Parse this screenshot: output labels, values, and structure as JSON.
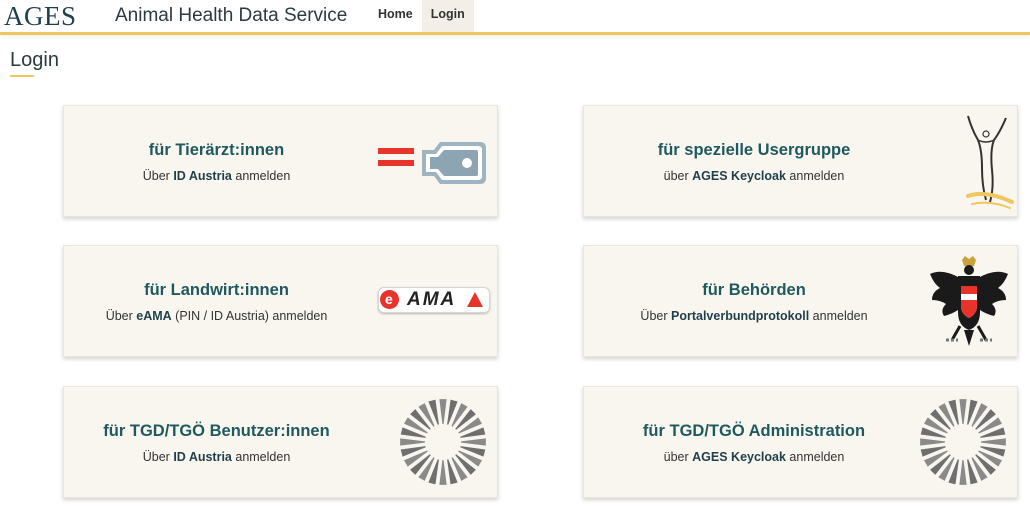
{
  "header": {
    "logo_text": "AGES",
    "app_title": "Animal Health Data Service",
    "nav": [
      {
        "label": "Home"
      },
      {
        "label": "Login"
      }
    ]
  },
  "page": {
    "title": "Login"
  },
  "cards": [
    {
      "title": "für Tierärzt:innen",
      "sub_pre": "Über ",
      "sub_bold": "ID Austria",
      "sub_post": " anmelden",
      "icon": "id-austria-key-icon"
    },
    {
      "title": "für spezielle Usergruppe",
      "sub_pre": "über ",
      "sub_bold": "AGES Keycloak",
      "sub_post": " anmelden",
      "icon": "keycloak-figure-icon"
    },
    {
      "title": "für Landwirt:innen",
      "sub_pre": "Über ",
      "sub_bold": "eAMA",
      "sub_post": " (PIN / ID Austria) anmelden",
      "icon": "eama-logo-icon",
      "icon_text": "AMA"
    },
    {
      "title": "für Behörden",
      "sub_pre": "Über ",
      "sub_bold": "Portalverbundprotokoll",
      "sub_post": " anmelden",
      "icon": "austrian-eagle-icon"
    },
    {
      "title": "für TGD/TGÖ Benutzer:innen",
      "sub_pre": "Über ",
      "sub_bold": "ID Austria",
      "sub_post": " anmelden",
      "icon": "sunburst-icon"
    },
    {
      "title": "für TGD/TGÖ Administration",
      "sub_pre": "über ",
      "sub_bold": "AGES Keycloak",
      "sub_post": " anmelden",
      "icon": "sunburst-icon"
    }
  ],
  "colors": {
    "accent": "#f0c75e",
    "card_bg": "#f9f6f0",
    "title_teal": "#1f5960",
    "austria_red": "#e8332a"
  }
}
